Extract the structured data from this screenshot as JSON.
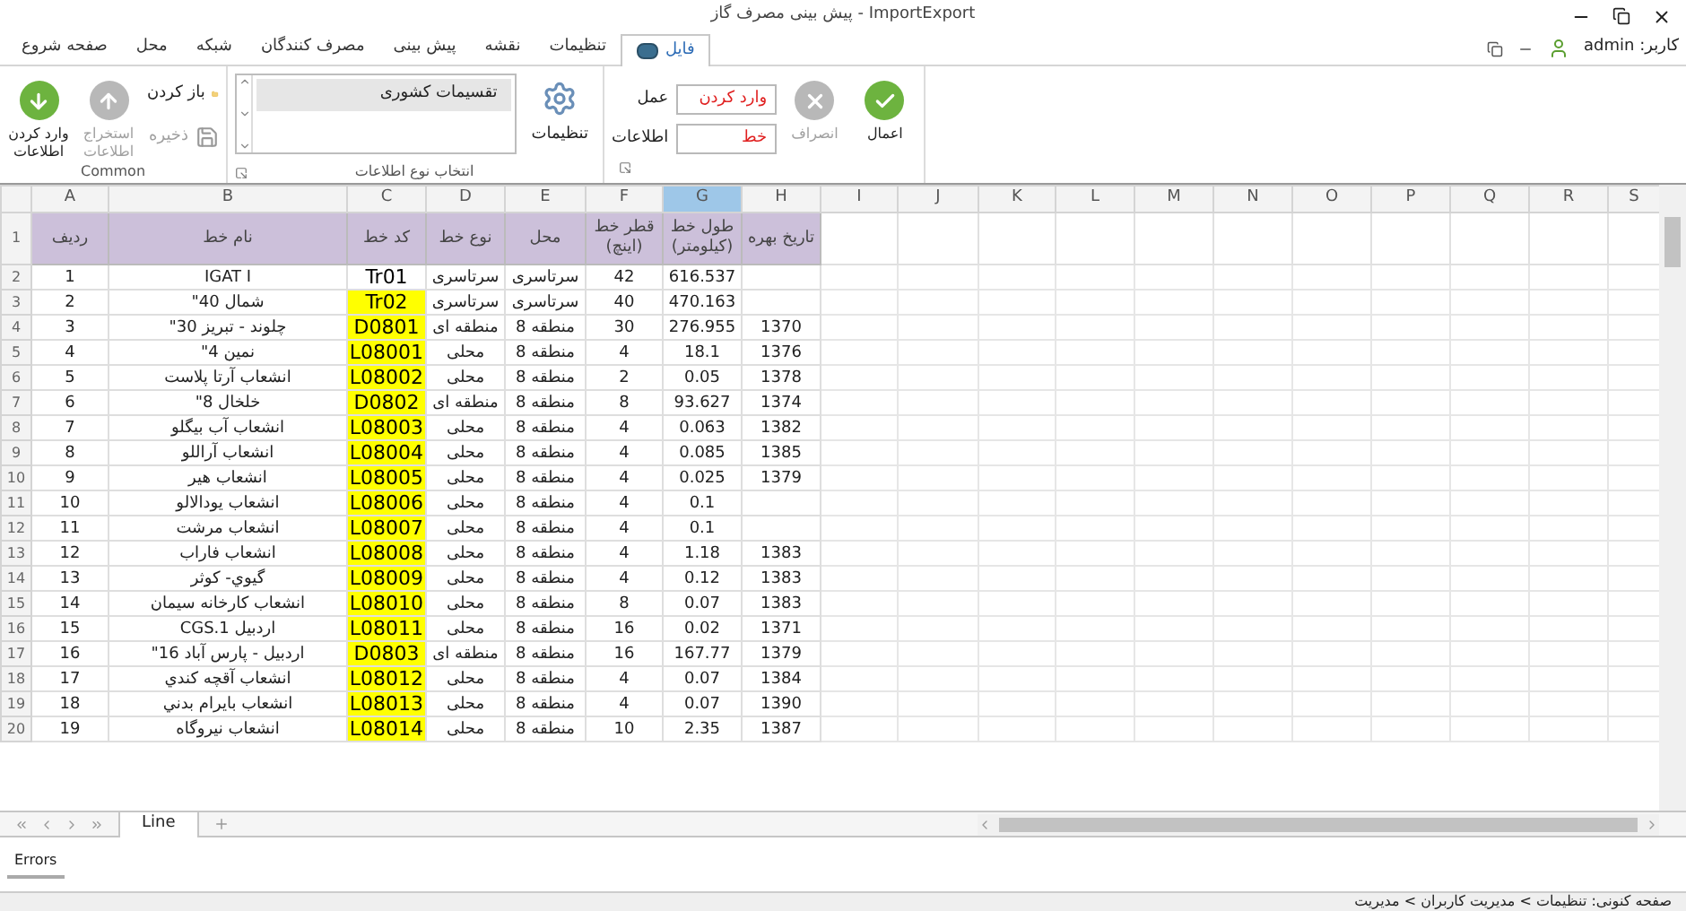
{
  "window": {
    "title": "پیش بینی مصرف گاز - ImportExport"
  },
  "user": {
    "label": "کاربر: admin"
  },
  "ribbon_tabs": [
    {
      "label": "فایل",
      "selected": true
    },
    {
      "label": "تنظیمات",
      "selected": false
    },
    {
      "label": "نقشه",
      "selected": false
    },
    {
      "label": "پیش بینی",
      "selected": false
    },
    {
      "label": "مصرف کنندگان",
      "selected": false
    },
    {
      "label": "شبکه",
      "selected": false
    },
    {
      "label": "محل",
      "selected": false
    },
    {
      "label": "صفحه شروع",
      "selected": false
    }
  ],
  "action_group": {
    "apply_button": {
      "label": "اعمال",
      "disabled": false
    },
    "cancel_button": {
      "label": "انصراف",
      "disabled": true
    },
    "fields": [
      {
        "label": "عمل",
        "value": "وارد کردن"
      },
      {
        "label": "اطلاعات",
        "value": "خط"
      }
    ]
  },
  "data_type_group": {
    "caption": "انتخاب نوع اطلاعات",
    "settings_button": {
      "label": "تنظیمات"
    },
    "list": [
      {
        "label": "تقسیمات کشوری",
        "selected": true
      }
    ]
  },
  "common_group": {
    "caption": "Common",
    "buttons": [
      {
        "kind": "open",
        "label": "باز کردن",
        "disabled": false
      },
      {
        "kind": "save",
        "label": "ذخیره",
        "disabled": true
      },
      {
        "kind": "export",
        "label": "استخراج اطلاعات",
        "disabled": true
      },
      {
        "kind": "import",
        "label": "وارد کردن اطلاعات",
        "disabled": false
      }
    ]
  },
  "columns": [
    {
      "label": "S",
      "selected": false
    },
    {
      "label": "R",
      "selected": false
    },
    {
      "label": "Q",
      "selected": false
    },
    {
      "label": "P",
      "selected": false
    },
    {
      "label": "O",
      "selected": false
    },
    {
      "label": "N",
      "selected": false
    },
    {
      "label": "M",
      "selected": false
    },
    {
      "label": "L",
      "selected": false
    },
    {
      "label": "K",
      "selected": false
    },
    {
      "label": "J",
      "selected": false
    },
    {
      "label": "I",
      "selected": false
    },
    {
      "label": "H",
      "selected": false
    },
    {
      "label": "G",
      "selected": true
    },
    {
      "label": "F",
      "selected": false
    },
    {
      "label": "E",
      "selected": false
    },
    {
      "label": "D",
      "selected": false
    },
    {
      "label": "C",
      "selected": false
    },
    {
      "label": "B",
      "selected": false
    },
    {
      "label": "A",
      "selected": false
    }
  ],
  "header_row": {
    "row": "1",
    "cells": [
      "تاریخ بهره",
      "طول خط (کیلومتر)",
      "قطر خط (اینچ)",
      "محل",
      "نوع خط",
      "کد خط",
      "نام خط",
      "ردیف"
    ]
  },
  "rows": [
    {
      "row": "2",
      "no": "1",
      "name": "IGAT I",
      "code": "Tr01",
      "code_highlighted": false,
      "type": "سرتاسری",
      "location": "سرتاسری",
      "diameter": "42",
      "length": "616.537"
    },
    {
      "row": "3",
      "no": "2",
      "name": "شمال 40\"",
      "code": "Tr02",
      "code_highlighted": true,
      "type": "سرتاسری",
      "location": "سرتاسری",
      "diameter": "40",
      "length": "470.163"
    },
    {
      "row": "4",
      "no": "3",
      "name": "چلوند - تبریز 30\"",
      "code": "D0801",
      "code_highlighted": true,
      "type": "منطقه ای",
      "location": "منطقه 8",
      "diameter": "30",
      "length": "276.955",
      "year": "1370"
    },
    {
      "row": "5",
      "no": "4",
      "name": "نمین 4\"",
      "code": "L08001",
      "code_highlighted": true,
      "type": "محلی",
      "location": "منطقه 8",
      "diameter": "4",
      "length": "18.1",
      "year": "1376"
    },
    {
      "row": "6",
      "no": "5",
      "name": "انشعاب آرتا پلاست",
      "code": "L08002",
      "code_highlighted": true,
      "type": "محلی",
      "location": "منطقه 8",
      "diameter": "2",
      "length": "0.05",
      "year": "1378"
    },
    {
      "row": "7",
      "no": "6",
      "name": "خلخال 8\"",
      "code": "D0802",
      "code_highlighted": true,
      "type": "منطقه ای",
      "location": "منطقه 8",
      "diameter": "8",
      "length": "93.627",
      "year": "1374"
    },
    {
      "row": "8",
      "no": "7",
      "name": "انشعاب آب بیگلو",
      "code": "L08003",
      "code_highlighted": true,
      "type": "محلی",
      "location": "منطقه 8",
      "diameter": "4",
      "length": "0.063",
      "year": "1382"
    },
    {
      "row": "9",
      "no": "8",
      "name": "انشعاب آراللو",
      "code": "L08004",
      "code_highlighted": true,
      "type": "محلی",
      "location": "منطقه 8",
      "diameter": "4",
      "length": "0.085",
      "year": "1385"
    },
    {
      "row": "10",
      "no": "9",
      "name": "انشعاب هیر",
      "code": "L08005",
      "code_highlighted": true,
      "type": "محلی",
      "location": "منطقه 8",
      "diameter": "4",
      "length": "0.025",
      "year": "1379"
    },
    {
      "row": "11",
      "no": "10",
      "name": "انشعاب یودالالو",
      "code": "L08006",
      "code_highlighted": true,
      "type": "محلی",
      "location": "منطقه 8",
      "diameter": "4",
      "length": "0.1"
    },
    {
      "row": "12",
      "no": "11",
      "name": "انشعاب مرشت",
      "code": "L08007",
      "code_highlighted": true,
      "type": "محلی",
      "location": "منطقه 8",
      "diameter": "4",
      "length": "0.1"
    },
    {
      "row": "13",
      "no": "12",
      "name": "انشعاب فاراب",
      "code": "L08008",
      "code_highlighted": true,
      "type": "محلی",
      "location": "منطقه 8",
      "diameter": "4",
      "length": "1.18",
      "year": "1383"
    },
    {
      "row": "14",
      "no": "13",
      "name": "گیوي- کوثر",
      "code": "L08009",
      "code_highlighted": true,
      "type": "محلی",
      "location": "منطقه 8",
      "diameter": "4",
      "length": "0.12",
      "year": "1383"
    },
    {
      "row": "15",
      "no": "14",
      "name": "انشعاب کارخانه سیمان",
      "code": "L08010",
      "code_highlighted": true,
      "type": "محلی",
      "location": "منطقه 8",
      "diameter": "8",
      "length": "0.07",
      "year": "1383"
    },
    {
      "row": "16",
      "no": "15",
      "name": "اردبیل CGS.1",
      "code": "L08011",
      "code_highlighted": true,
      "type": "محلی",
      "location": "منطقه 8",
      "diameter": "16",
      "length": "0.02",
      "year": "1371"
    },
    {
      "row": "17",
      "no": "16",
      "name": "اردبیل - پارس آباد 16\"",
      "code": "D0803",
      "code_highlighted": true,
      "type": "منطقه ای",
      "location": "منطقه 8",
      "diameter": "16",
      "length": "167.77",
      "year": "1379"
    },
    {
      "row": "18",
      "no": "17",
      "name": "انشعاب آقچه کندي",
      "code": "L08012",
      "code_highlighted": true,
      "type": "محلی",
      "location": "منطقه 8",
      "diameter": "4",
      "length": "0.07",
      "year": "1384"
    },
    {
      "row": "19",
      "no": "18",
      "name": "انشعاب بایرام بدني",
      "code": "L08013",
      "code_highlighted": true,
      "type": "محلی",
      "location": "منطقه 8",
      "diameter": "4",
      "length": "0.07",
      "year": "1390"
    },
    {
      "row": "20",
      "no": "19",
      "name": "انشعاب نیروگاه",
      "code": "L08014",
      "code_highlighted": true,
      "type": "محلی",
      "location": "منطقه 8",
      "diameter": "10",
      "length": "2.35",
      "year": "1387"
    }
  ],
  "sheet_tabs": [
    {
      "label": "Line",
      "selected": true
    }
  ],
  "bottom_panel": {
    "tab": "Errors"
  },
  "status_bar": {
    "text": "صفحه کنونی: تنظیمات > مدیریت کاربران > مدیریت"
  }
}
